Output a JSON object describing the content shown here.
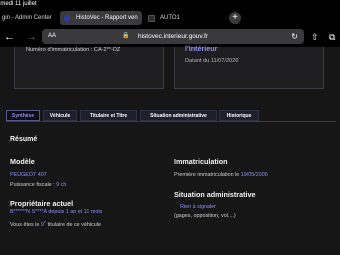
{
  "status_bar": {
    "date": "amedi 11 juillet"
  },
  "browser": {
    "tabs": [
      {
        "label": "gin - Admin Center"
      },
      {
        "label": "HistoVec - Rapport ven"
      },
      {
        "label": "AUTO1"
      }
    ],
    "new_tab": "+",
    "url": "histovec.interieur.gouv.fr",
    "reader": "AA"
  },
  "header": {
    "immatriculation": "Numéro d'immatriculation : CA-2**-DZ",
    "ministere": "l'Intérieur",
    "date": "Datant du 11/07/2026"
  },
  "tabs": [
    {
      "label": "Synthèse"
    },
    {
      "label": "Véhicule"
    },
    {
      "label": "Titulaire et Titre"
    },
    {
      "label": "Situation administrative"
    },
    {
      "label": "Historique"
    }
  ],
  "resume": {
    "heading": "Résumé"
  },
  "modele": {
    "heading": "Modèle",
    "name": "PEUGEOT 407",
    "puissance_label": "Puissance fiscale : ",
    "puissance_value": "9 ch"
  },
  "proprietaire": {
    "heading": "Propriétaire actuel",
    "name_prefix": "B******N S****A depuis ",
    "duration": "1 an et 11 mois",
    "titulaire_prefix": "Vous êtes le ",
    "rank": "9",
    "rank_sup": "e",
    "titulaire_suffix": " titulaire de ce véhicule"
  },
  "immatriculation": {
    "heading": "Immatriculation",
    "premiere_label": "Première immatriculation le ",
    "premiere_date": "19/05/2006"
  },
  "situation": {
    "heading": "Situation administrative",
    "status": "Rien à signaler",
    "detail": "(gages, opposition, vol,...)"
  }
}
